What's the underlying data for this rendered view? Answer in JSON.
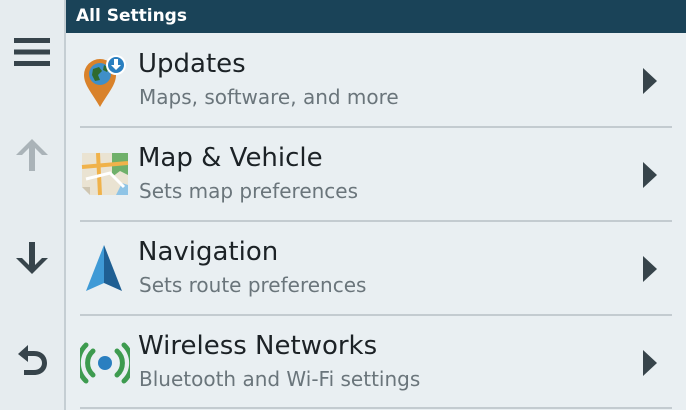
{
  "header": {
    "title": "All Settings"
  },
  "sidebar": {
    "menu_icon": "hamburger-menu-icon",
    "up_icon": "arrow-up-icon",
    "down_icon": "arrow-down-icon",
    "back_icon": "back-return-icon"
  },
  "settings": [
    {
      "title": "Updates",
      "subtitle": "Maps, software, and more",
      "icon": "updates-globe-pin-icon"
    },
    {
      "title": "Map & Vehicle",
      "subtitle": "Sets map preferences",
      "icon": "map-icon"
    },
    {
      "title": "Navigation",
      "subtitle": "Sets route preferences",
      "icon": "navigation-arrow-icon"
    },
    {
      "title": "Wireless Networks",
      "subtitle": "Bluetooth and Wi-Fi settings",
      "icon": "wireless-icon"
    }
  ],
  "colors": {
    "header_bg": "#1a4358",
    "background": "#e9eff2",
    "accent_blue": "#2a7fc0",
    "accent_green": "#3d9b4f",
    "accent_orange": "#d9822b"
  }
}
